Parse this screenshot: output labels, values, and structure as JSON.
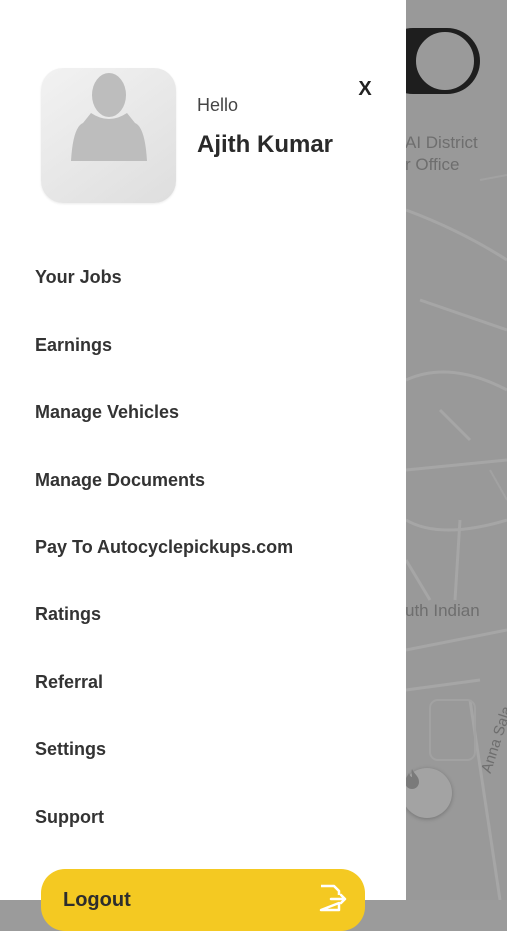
{
  "map": {
    "labels": [
      "AI District",
      "r Office",
      "uth Indian",
      "Anna Sala"
    ]
  },
  "drawer": {
    "greeting": "Hello",
    "user_name": "Ajith Kumar",
    "close_label": "X",
    "menu": [
      {
        "label": "Your Jobs"
      },
      {
        "label": "Earnings"
      },
      {
        "label": "Manage Vehicles"
      },
      {
        "label": "Manage Documents"
      },
      {
        "label": "Pay To Autocyclepickups.com"
      },
      {
        "label": "Ratings"
      },
      {
        "label": "Referral"
      },
      {
        "label": "Settings"
      },
      {
        "label": "Support"
      }
    ],
    "logout_label": "Logout"
  },
  "colors": {
    "accent": "#f4c922",
    "map_overlay": "#999999"
  }
}
